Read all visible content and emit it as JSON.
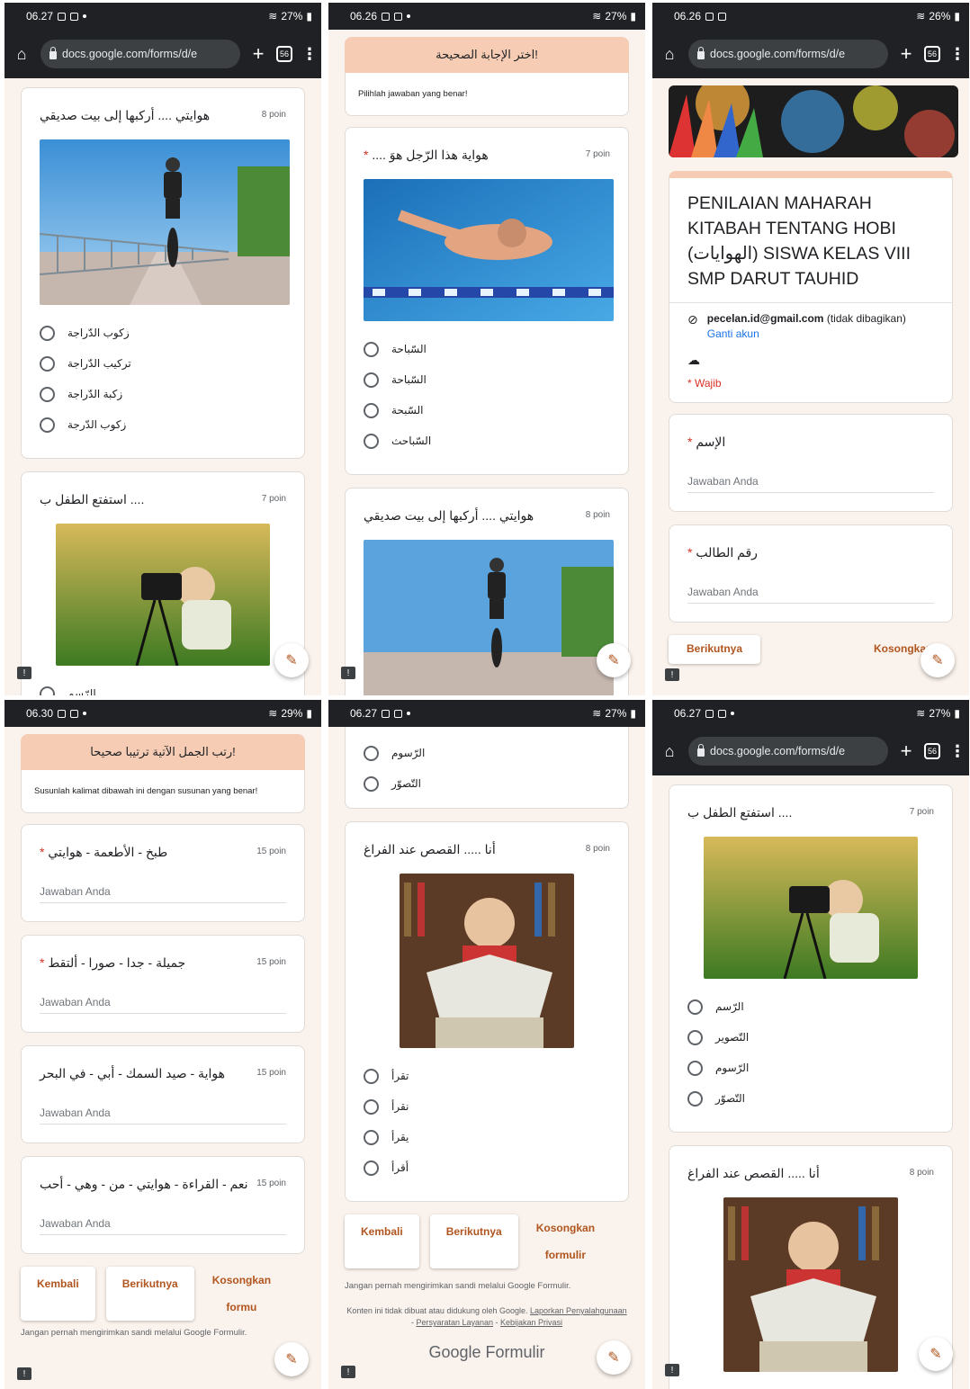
{
  "status": {
    "s1": "06.27",
    "s2": "06.26",
    "s3": "06.26",
    "s4": "06.30",
    "s5": "06.27",
    "s6": "06.27",
    "b1": "27%",
    "b2": "27%",
    "b3": "26%",
    "b4": "29%",
    "b5": "27%",
    "b6": "27%"
  },
  "browser": {
    "url": "docs.google.com/forms/d/e",
    "tabs": "56"
  },
  "points": {
    "p7": "7 poin",
    "p8": "8 poin",
    "p15": "15 poin"
  },
  "answer_placeholder": "Jawaban Anda",
  "nav": {
    "back": "Kembali",
    "next": "Berikutnya",
    "clear": "Kosongkan formulir",
    "clear_cut": "Kosongkan fo",
    "clear_a": "Kosongkan",
    "clear_b": "formulir",
    "clear_b_cut": "formu"
  },
  "footer": {
    "never": "Jangan pernah mengirimkan sandi melalui Google Formulir.",
    "legal_pre": "Konten ini tidak dibuat atau didukung oleh Google.",
    "report": "Laporkan Penyalahgunaan",
    "terms": "Persyaratan Layanan",
    "privacy": "Kebijakan Privasi",
    "sep": " - ",
    "logo_google": "Google",
    "logo_forms": "Formulir"
  },
  "form": {
    "title": "PENILAIAN MAHARAH KITABAH TENTANG HOBI (الهوايات) SISWA KELAS VIII SMP DARUT TAUHID",
    "email": "pecelan.id@gmail.com",
    "not_shared": "(tidak dibagikan)",
    "switch": "Ganti akun",
    "required": "* Wajib"
  },
  "fields": {
    "name": "الإسم",
    "number": "رقم الطالب"
  },
  "sections": {
    "choose_title": "!اختر الإجابة الصحيحة",
    "choose_desc": "Pilihlah jawaban yang benar!",
    "order_title": "!رتب الجمل الآتية ترتيبا صحيحا",
    "order_desc": "Susunlah kalimat dibawah ini dengan susunan yang benar!"
  },
  "q_bike": {
    "title": "هوايتي .... أركبها إلى بيت صديقي",
    "options": [
      "زكوب الدّراجة",
      "تركيب الدّراجة",
      "زكبة الدّراجة",
      "زكوب الدّرجة"
    ]
  },
  "q_photo": {
    "title": ".... استفتع الطفل ب",
    "options": [
      "الرّسم",
      "التّصوير",
      "الرّسوم",
      "التّصوّر"
    ]
  },
  "q_swim": {
    "title": "هواية هذا الرّجل هوَ ....",
    "options": [
      "السّباحة",
      "السّباحة",
      "السّبحة",
      "السّباحث"
    ]
  },
  "q_read": {
    "title": "أنا ..... القصص عند الفراغ",
    "options": [
      "تقرأ",
      "نقرأ",
      "يقرأ",
      "أقرأ"
    ]
  },
  "order": {
    "q1": "طبخ - الأطعمة - هوايتي",
    "q2": "جميلة - جدا - صورا - ألتقط",
    "q3": "هواية - صيد السمك - أبي - في البحر",
    "q4": "نعم - القراءة - هوايتي - من - وهي - أحب"
  },
  "icons": {
    "home": "home-icon",
    "plus": "plus-icon",
    "menu": "kebab-menu-icon",
    "edit": "pencil-icon",
    "feedback": "feedback-icon"
  },
  "colors": {
    "accent": "#f6cdb4",
    "button_text": "#b0551f",
    "required": "#d93025",
    "link": "#1a73e8"
  }
}
